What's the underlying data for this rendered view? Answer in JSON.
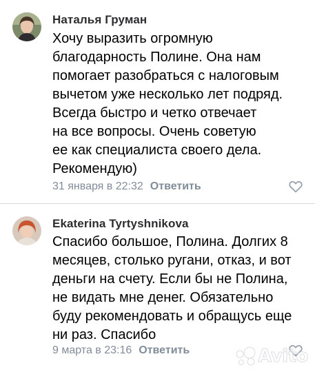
{
  "comments": [
    {
      "author": "Наталья Груман",
      "text": "Хочу выразить огромную\nблагодарность Полине. Она нам\nпомогает разобраться с налоговым\nвычетом уже несколько лет подряд.\nВсегда быстро и четко отвечает\nна все вопросы. Очень советую\nее как специалиста своего дела.\nРекомендую)",
      "timestamp": "31 января в 22:32",
      "reply_label": "Ответить",
      "like_icon": "heart-outline-icon"
    },
    {
      "author": "Ekaterina Tyrtyshnikova",
      "text": "Спасибо большое, Полина. Долгих 8\nмесяцев, столько ругани, отказ, и вот\nденьги на счету. Если бы не Полина,\nне видать мне денег. Обязательно\nбуду рекомендовать и обращусь еще\nни раз. Спасибо",
      "timestamp": "9 марта в 23:16",
      "reply_label": "Ответить",
      "like_icon": "heart-outline-icon"
    }
  ],
  "watermark": {
    "text": "Avito"
  },
  "colors": {
    "meta_text": "#818c99",
    "divider": "#d7d8d9",
    "author_text": "#2c2d2e"
  }
}
